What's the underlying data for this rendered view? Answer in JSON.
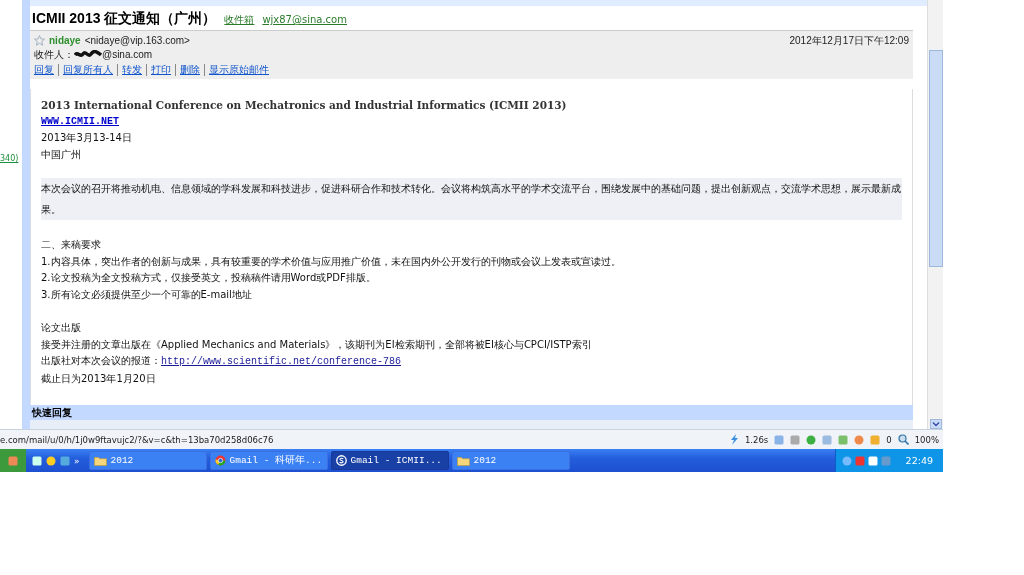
{
  "email": {
    "subject": "ICMII 2013 征文通知（广州）",
    "labels": [
      {
        "text": "收件箱"
      },
      {
        "text": "wjx87@sina.com"
      }
    ],
    "starred": false,
    "sender_name": "nidaye",
    "sender_address": "<nidaye@vip.163.com>",
    "date": "2012年12月17日下午12:09",
    "recipient_label": "收件人：",
    "recipient_domain": "@sina.com",
    "actions": [
      "回复",
      "回复所有人",
      "转发",
      "打印",
      "删除",
      "显示原始邮件"
    ]
  },
  "body": {
    "title": "2013 International Conference on Mechatronics and Industrial Informatics (ICMII 2013)",
    "website": "WWW.ICMII.NET",
    "date_line": "2013年3月13-14日",
    "place": "中国广州",
    "intro": "本次会议的召开将推动机电、信息领域的学科发展和科技进步，促进科研合作和技术转化。会议将构筑高水平的学术交流平台，围绕发展中的基础问题，提出创新观点，交流学术思想，展示最新成果。",
    "section_heading": "二、来稿要求",
    "requirements": [
      "1.内容具体，突出作者的创新与成果，具有较重要的学术价值与应用推广价值，未在国内外公开发行的刊物或会议上发表或宣读过。",
      "2.论文投稿为全文投稿方式，仅接受英文，投稿稿件请用Word或PDF排版。",
      "3.所有论文必须提供至少一个可靠的E-mail地址"
    ],
    "publish_heading": "论文出版",
    "publish_text": "接受并注册的文章出版在《Applied Mechanics and Materials》，该期刊为EI检索期刊，全部将被EI核心与CPCI/ISTP索引",
    "report_label": "出版社对本次会议的报道：",
    "report_link": "http://www.scientific.net/conference-786",
    "deadline": "截止日为2013年1月20日"
  },
  "quick_reply": {
    "title": "快速回复"
  },
  "side_note": "340)",
  "status_bar": {
    "url": "e.com/mail/u/0/h/1j0w9ftavujc2/?&v=c&th=13ba70d258d06c76",
    "load_time": "1.26s",
    "count": "0",
    "zoom": "100%"
  },
  "taskbar": {
    "chevron": "»",
    "tasks": [
      {
        "label": "2012",
        "kind": "folder",
        "selected": false
      },
      {
        "label": "Gmail - 科研年...",
        "kind": "chrome",
        "selected": false
      },
      {
        "label": "Gmail - ICMII...",
        "kind": "browser",
        "selected": true
      },
      {
        "label": "2012",
        "kind": "folder",
        "selected": false
      }
    ],
    "clock": "22:49"
  }
}
